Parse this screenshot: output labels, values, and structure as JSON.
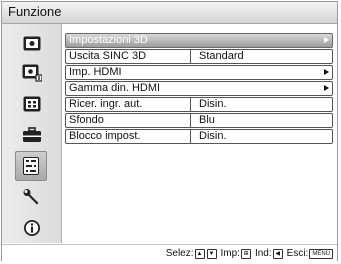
{
  "header": {
    "title": "Funzione"
  },
  "sidebar": {
    "items": [
      {
        "icon": "picture-icon",
        "selected": false
      },
      {
        "icon": "picture-settings-icon",
        "selected": false
      },
      {
        "icon": "screen-icon",
        "selected": false
      },
      {
        "icon": "setup-toolbox-icon",
        "selected": false
      },
      {
        "icon": "function-icon",
        "selected": true
      },
      {
        "icon": "wrench-icon",
        "selected": false
      },
      {
        "icon": "info-icon",
        "selected": false
      }
    ]
  },
  "menu": {
    "rows": [
      {
        "label": "Impostazioni 3D",
        "value": "",
        "has_submenu": true,
        "selected": true
      },
      {
        "label": "Uscita SINC 3D",
        "value": "Standard",
        "has_submenu": false,
        "selected": false
      },
      {
        "label": "Imp. HDMI",
        "value": "",
        "has_submenu": true,
        "selected": false
      },
      {
        "label": "Gamma din. HDMI",
        "value": "",
        "has_submenu": true,
        "selected": false
      },
      {
        "label": "Ricer. ingr. aut.",
        "value": "Disin.",
        "has_submenu": false,
        "selected": false
      },
      {
        "label": "Sfondo",
        "value": "Blu",
        "has_submenu": false,
        "selected": false
      },
      {
        "label": "Blocco impost.",
        "value": "Disin.",
        "has_submenu": false,
        "selected": false
      }
    ]
  },
  "footer": {
    "selez_label": "Selez:",
    "imp_label": "Imp:",
    "ind_label": "Ind:",
    "esci_label": "Esci:",
    "up_key": "▲",
    "down_key": "▼",
    "enter_key": "⊞",
    "left_key": "◀",
    "menu_key": "MENU"
  }
}
